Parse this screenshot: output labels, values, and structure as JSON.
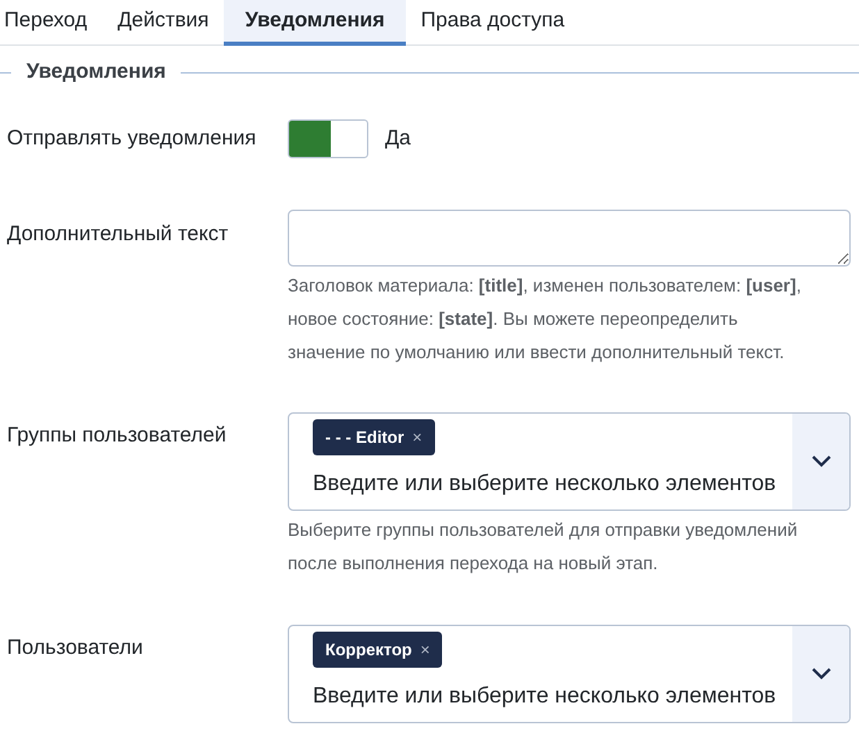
{
  "tabs": [
    {
      "label": "Переход",
      "selected": false
    },
    {
      "label": "Действия",
      "selected": false
    },
    {
      "label": "Уведомления",
      "selected": true
    },
    {
      "label": "Права доступа",
      "selected": false
    }
  ],
  "legend": "Уведомления",
  "fields": [
    {
      "kind": "toggle",
      "label": "Отправлять уведомления",
      "on": true,
      "value_label": "Да"
    },
    {
      "kind": "textarea",
      "label": "Дополнительный текст",
      "help": "Заголовок материала: **[title]**, изменен пользователем: **[user]**, новое состояние: **[state]**. Вы можете переопределить значение по умолчанию или ввести дополнительный текст."
    },
    {
      "kind": "multiselect",
      "label": "Группы пользователей",
      "tags": [
        {
          "text": "- - - Editor",
          "remove": "×"
        }
      ],
      "placeholder": "Введите или выберите несколько элементов",
      "help": "Выберите группы пользователей для отправки уведомлений после выполнения перехода на новый этап."
    },
    {
      "kind": "multiselect",
      "label": "Пользователи",
      "tags": [
        {
          "text": "Корректор",
          "remove": "×"
        }
      ],
      "placeholder": "Введите или выберите несколько элементов"
    }
  ]
}
